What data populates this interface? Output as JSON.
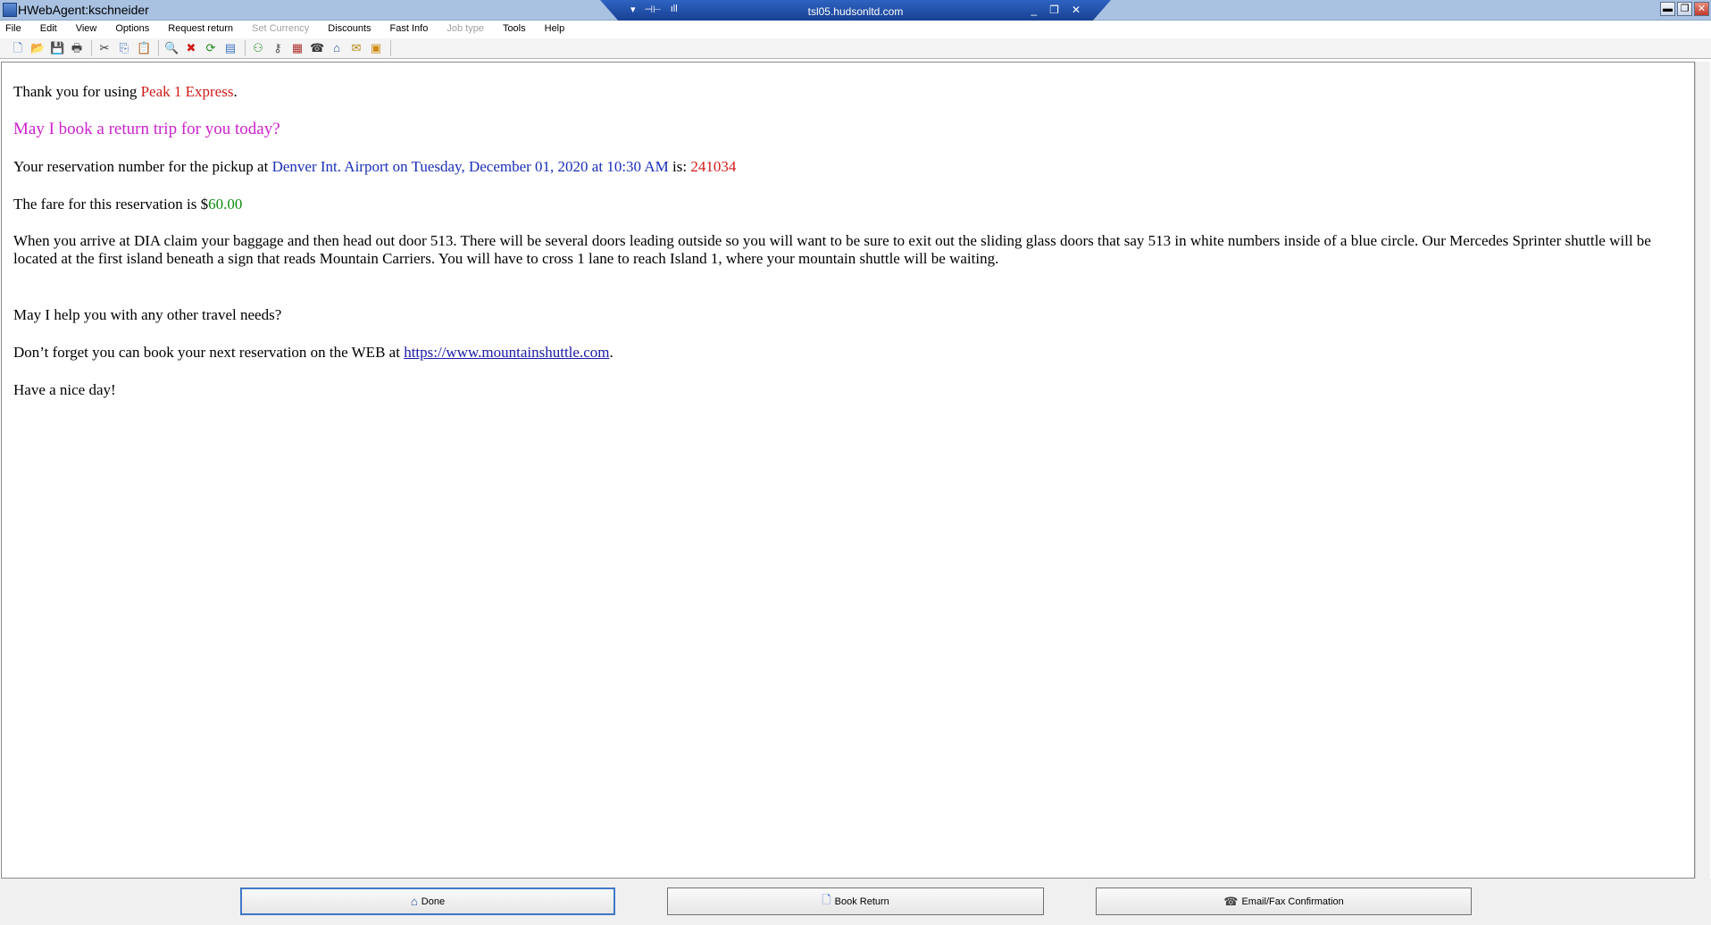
{
  "window": {
    "title": "HWebAgent:kschneider",
    "minimize": "▬",
    "restore": "❐",
    "close": "✕"
  },
  "rdp": {
    "left_icons": [
      "▾",
      "⊣⊢",
      "ıll"
    ],
    "host": "tsl05.hudsonltd.com",
    "right_icons": [
      "_",
      "❐",
      "✕"
    ]
  },
  "menu": [
    {
      "label": "File",
      "disabled": false
    },
    {
      "label": "Edit",
      "disabled": false
    },
    {
      "label": "View",
      "disabled": false
    },
    {
      "label": "Options",
      "disabled": false
    },
    {
      "label": "Request return",
      "disabled": false
    },
    {
      "label": "Set Currency",
      "disabled": true
    },
    {
      "label": "Discounts",
      "disabled": false
    },
    {
      "label": "Fast Info",
      "disabled": false
    },
    {
      "label": "Job type",
      "disabled": true
    },
    {
      "label": "Tools",
      "disabled": false
    },
    {
      "label": "Help",
      "disabled": false
    }
  ],
  "toolbar": {
    "group1": [
      {
        "name": "new-doc-icon",
        "glyph": "🗋"
      },
      {
        "name": "open-folder-icon",
        "glyph": "📂"
      },
      {
        "name": "save-icon",
        "glyph": "💾"
      },
      {
        "name": "print-icon",
        "glyph": "🖶"
      }
    ],
    "group2": [
      {
        "name": "cut-icon",
        "glyph": "✂"
      },
      {
        "name": "copy-icon",
        "glyph": "⎘"
      },
      {
        "name": "paste-icon",
        "glyph": "📋"
      }
    ],
    "group3": [
      {
        "name": "find-icon",
        "glyph": "🔍"
      },
      {
        "name": "delete-icon",
        "glyph": "✖"
      },
      {
        "name": "refresh-doc-icon",
        "glyph": "⟳"
      },
      {
        "name": "document-icon",
        "glyph": "▤"
      }
    ],
    "group4": [
      {
        "name": "users-icon",
        "glyph": "⚇"
      },
      {
        "name": "key-icon",
        "glyph": "⚷"
      },
      {
        "name": "report-icon",
        "glyph": "▦"
      },
      {
        "name": "fax-icon",
        "glyph": "☎"
      },
      {
        "name": "home-icon",
        "glyph": "⌂"
      },
      {
        "name": "envelope-icon",
        "glyph": "✉"
      },
      {
        "name": "note-icon",
        "glyph": "▣"
      }
    ]
  },
  "colors": {
    "company": "#d21b1b",
    "lead_question": "#cc22cc",
    "detail_blue": "#1a2fb8",
    "fare_green": "#0f8a0f"
  },
  "message": {
    "thanks_prefix": "Thank you for using ",
    "company": "Peak 1 Express",
    "thanks_suffix": ".",
    "return_question": "May I book a return trip for you today?",
    "res_prefix": "Your reservation number for the pickup at ",
    "pickup_location": "Denver Int. Airport",
    "res_on": " on ",
    "pickup_date": "Tuesday, December 01, 2020",
    "res_at": " at ",
    "pickup_time": "10:30 AM",
    "res_is": " is: ",
    "reservation_number": "241034",
    "fare_prefix": "The fare for this reservation is $",
    "fare_amount": "60.00",
    "instructions": "When you arrive at DIA claim your baggage and then head out door 513. There will be several doors leading outside so you will want to be sure to exit out the sliding glass doors that say 513 in white numbers inside of a blue circle. Our Mercedes Sprinter shuttle will be located at the first island beneath a sign that reads Mountain Carriers. You will have to cross 1 lane to reach Island 1, where your mountain shuttle will be waiting.",
    "help_question": "May I help you with any other travel needs?",
    "web_prefix": "Don’t forget you can book your next reservation on the WEB at ",
    "web_link": "https://www.mountainshuttle.com",
    "web_suffix": ".",
    "closing": "Have a nice day!"
  },
  "buttons": {
    "done": "Done",
    "book_return": "Book Return",
    "email_fax": "Email/Fax Confirmation"
  }
}
